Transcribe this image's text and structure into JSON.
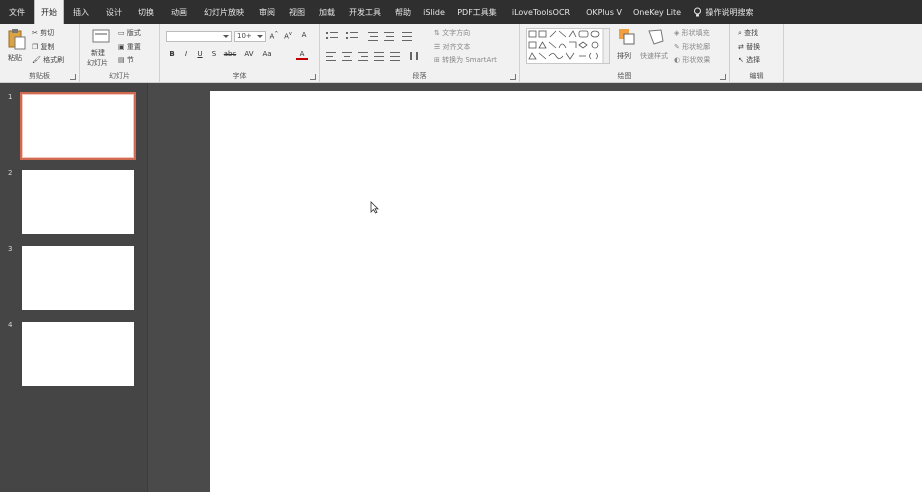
{
  "tabs": [
    {
      "label": "文件",
      "active": false
    },
    {
      "label": "开始",
      "active": true
    },
    {
      "label": "插入",
      "active": false
    },
    {
      "label": "设计",
      "active": false
    },
    {
      "label": "切换",
      "active": false
    },
    {
      "label": "动画",
      "active": false
    },
    {
      "label": "幻灯片放映",
      "active": false
    },
    {
      "label": "审阅",
      "active": false
    },
    {
      "label": "视图",
      "active": false
    },
    {
      "label": "加载",
      "active": false
    },
    {
      "label": "开发工具",
      "active": false
    },
    {
      "label": "帮助",
      "active": false
    },
    {
      "label": "iSlide",
      "active": false
    },
    {
      "label": "PDF工具集",
      "active": false
    },
    {
      "label": "iLoveToolsOCR",
      "active": false
    },
    {
      "label": "OKPlus V",
      "active": false
    },
    {
      "label": "OneKey Lite",
      "active": false
    },
    {
      "label": "操作说明搜索",
      "active": false,
      "icon": "lightbulb-icon"
    }
  ],
  "ribbon": {
    "clipboard": {
      "label": "剪贴板",
      "paste": "粘贴",
      "cut": "剪切",
      "copy": "复制",
      "format_painter": "格式刷"
    },
    "slides": {
      "label": "幻灯片",
      "new_slide": "新建",
      "new_slide_sub": "幻灯片",
      "layout": "版式",
      "reset": "重置",
      "section": "节"
    },
    "font": {
      "label": "字体",
      "font_name": "",
      "font_size": "10+",
      "bold": "B",
      "italic": "I",
      "underline": "U",
      "shadow": "S",
      "strike": "abc",
      "spacing": "AV",
      "case": "Aa",
      "color": "A",
      "grow": "A",
      "shrink": "A",
      "clear": "A"
    },
    "paragraph": {
      "label": "段落",
      "text_direction": "文字方向",
      "align_text": "对齐文本",
      "smartart": "转换为 SmartArt"
    },
    "drawing": {
      "label": "绘图",
      "arrange": "排列",
      "quick_styles": "快速样式",
      "fill": "形状填充",
      "outline": "形状轮廓",
      "effects": "形状效果"
    },
    "editing": {
      "label": "编辑",
      "find": "查找",
      "replace": "替换",
      "select": "选择"
    }
  },
  "slides": [
    {
      "number": "1",
      "selected": true
    },
    {
      "number": "2",
      "selected": false
    },
    {
      "number": "3",
      "selected": false
    },
    {
      "number": "4",
      "selected": false
    }
  ],
  "colors": {
    "tabbar": "#2f2f2f",
    "ribbon": "#f1f1f1",
    "workspace": "#4a4a4a",
    "selection": "#d06a50"
  }
}
